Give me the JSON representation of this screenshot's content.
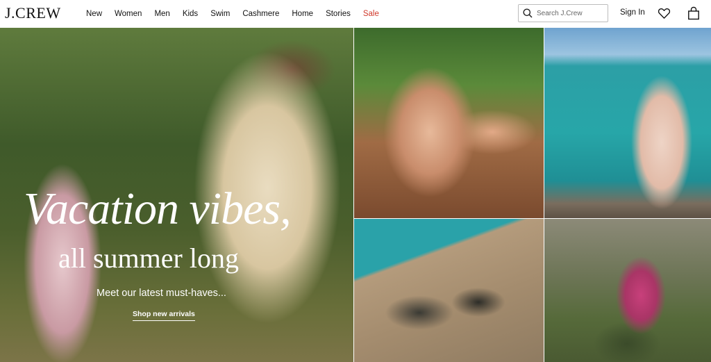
{
  "brand": {
    "logo_text": "J.CREW"
  },
  "nav": {
    "items": [
      {
        "label": "New"
      },
      {
        "label": "Women"
      },
      {
        "label": "Men"
      },
      {
        "label": "Kids"
      },
      {
        "label": "Swim"
      },
      {
        "label": "Cashmere"
      },
      {
        "label": "Home"
      },
      {
        "label": "Stories"
      },
      {
        "label": "Sale"
      }
    ]
  },
  "search": {
    "placeholder": "Search J.Crew",
    "icon": "search-icon"
  },
  "account": {
    "signin_label": "Sign In",
    "wishlist_icon": "heart-icon",
    "bag_icon": "shopping-bag-icon"
  },
  "hero": {
    "headline": "Vacation vibes,",
    "subhead": "all summer long",
    "tagline": "Meet our latest must-haves...",
    "cta_label": "Shop new arrivals"
  },
  "colors": {
    "sale": "#d0392b",
    "text": "#111111",
    "header_bg": "#ffffff"
  }
}
